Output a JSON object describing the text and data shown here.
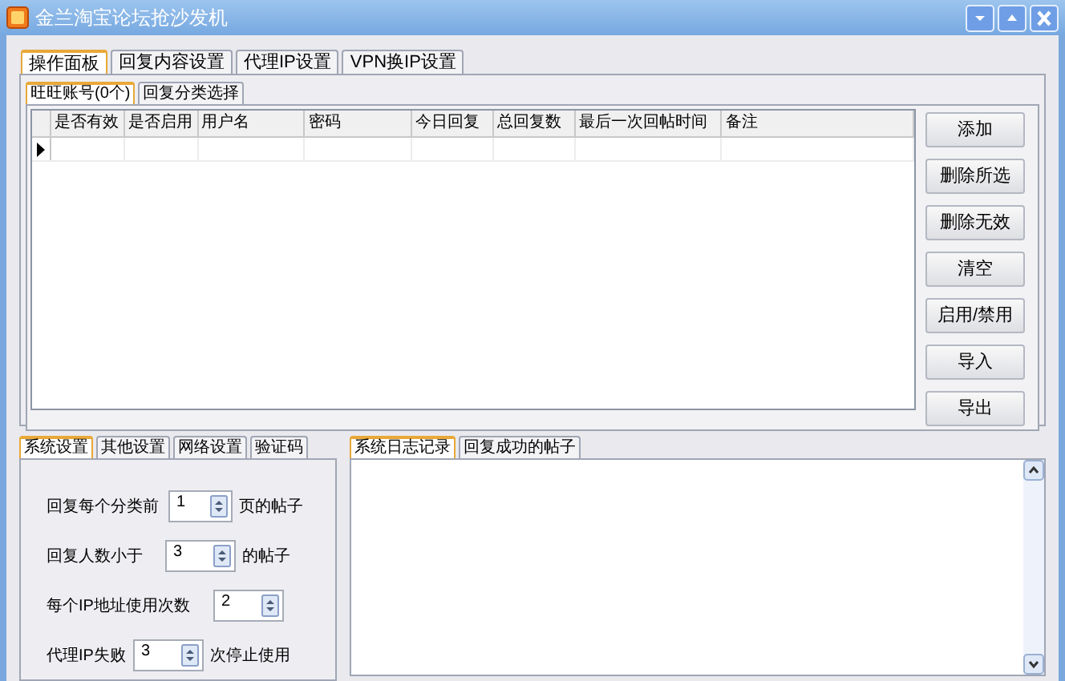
{
  "window": {
    "title": "金兰淘宝论坛抢沙发机"
  },
  "main_tabs": [
    {
      "label": "操作面板",
      "selected": true
    },
    {
      "label": "回复内容设置",
      "selected": false
    },
    {
      "label": "代理IP设置",
      "selected": false
    },
    {
      "label": "VPN换IP设置",
      "selected": false
    }
  ],
  "sub_tabs": [
    {
      "label": "旺旺账号(0个)",
      "selected": true
    },
    {
      "label": "回复分类选择",
      "selected": false
    }
  ],
  "table": {
    "columns": [
      "是否有效",
      "是否启用",
      "用户名",
      "密码",
      "今日回复",
      "总回复数",
      "最后一次回帖时间",
      "备注"
    ]
  },
  "buttons": [
    "添加",
    "删除所选",
    "删除无效",
    "清空",
    "启用/禁用",
    "导入",
    "导出"
  ],
  "settings_tabs": [
    {
      "label": "系统设置",
      "selected": true
    },
    {
      "label": "其他设置",
      "selected": false
    },
    {
      "label": "网络设置",
      "selected": false
    },
    {
      "label": "验证码",
      "selected": false
    }
  ],
  "settings": [
    {
      "before": "回复每个分类前",
      "value": "1",
      "after": "页的帖子"
    },
    {
      "before": "回复人数小于",
      "value": "3",
      "after": "的帖子"
    },
    {
      "before": "每个IP地址使用次数",
      "value": "2"
    },
    {
      "before": "代理IP失败",
      "value": "3",
      "after": "次停止使用"
    }
  ],
  "log_tabs": [
    {
      "label": "系统日志记录",
      "selected": true
    },
    {
      "label": "回复成功的帖子",
      "selected": false
    }
  ]
}
